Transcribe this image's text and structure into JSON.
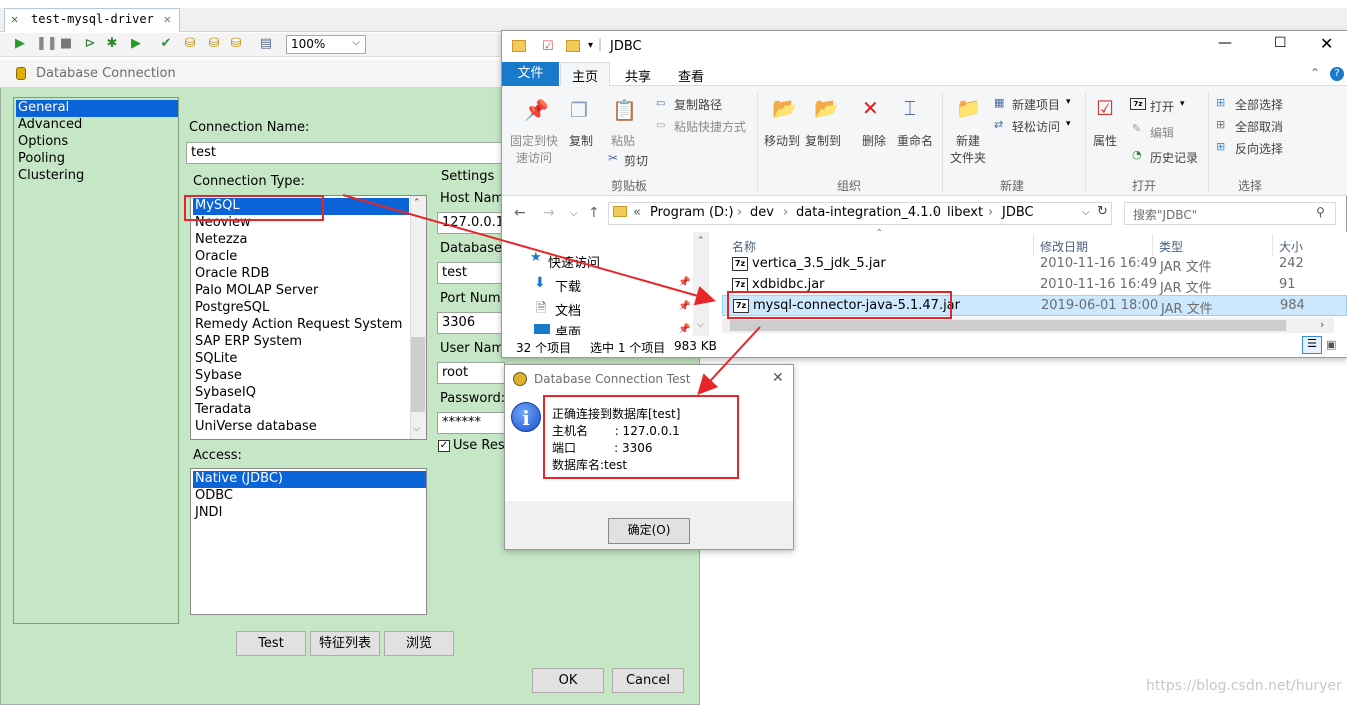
{
  "spoon": {
    "tab_label": "test-mysql-driver",
    "tab_icon": "transform-icon",
    "zoom": "100%",
    "toolbar_icons": [
      "run-icon",
      "pause-icon",
      "stop-icon",
      "preview-icon",
      "debug-icon",
      "replay-icon",
      "verify-icon",
      "impact-icon",
      "sql-icon",
      "explore-db-icon",
      "show-results-icon"
    ]
  },
  "db_dialog": {
    "title": "Database Connection",
    "nav": [
      "General",
      "Advanced",
      "Options",
      "Pooling",
      "Clustering"
    ],
    "selected_nav": "General",
    "connection_name_label": "Connection Name:",
    "connection_name_value": "test",
    "connection_type_label": "Connection Type:",
    "connection_types": [
      "MySQL",
      "Neoview",
      "Netezza",
      "Oracle",
      "Oracle RDB",
      "Palo MOLAP Server",
      "PostgreSQL",
      "Remedy Action Request System",
      "SAP ERP System",
      "SQLite",
      "Sybase",
      "SybaseIQ",
      "Teradata",
      "UniVerse database"
    ],
    "selected_type": "MySQL",
    "access_label": "Access:",
    "access_types": [
      "Native (JDBC)",
      "ODBC",
      "JNDI"
    ],
    "selected_access": "Native (JDBC)",
    "settings_label": "Settings",
    "host_label": "Host Name",
    "host_value": "127.0.0.1",
    "database_label": "Database",
    "database_value": "test",
    "port_label": "Port Numb",
    "port_value": "3306",
    "user_label": "User Name",
    "user_value": "root",
    "password_label": "Password:",
    "password_value": "******",
    "use_result_label": "Use Resu",
    "buttons": {
      "test": "Test",
      "features": "特征列表",
      "explore": "浏览",
      "ok": "OK",
      "cancel": "Cancel"
    }
  },
  "explorer": {
    "title": "JDBC",
    "tabs": {
      "file": "文件",
      "home": "主页",
      "share": "共享",
      "view": "查看"
    },
    "ribbon": {
      "pin": [
        "固定到快",
        "速访问"
      ],
      "copy": "复制",
      "paste": "粘贴",
      "copy_path": "复制路径",
      "paste_shortcut": "粘贴快捷方式",
      "cut": "剪切",
      "clipboard": "剪贴板",
      "move_to": "移动到",
      "copy_to": "复制到",
      "delete": "删除",
      "rename": "重命名",
      "organize": "组织",
      "new_folder": [
        "新建",
        "文件夹"
      ],
      "new_item": "新建项目",
      "easy_access": "轻松访问",
      "new_group": "新建",
      "properties": "属性",
      "open": "打开",
      "edit": "编辑",
      "history": "历史记录",
      "open_group": "打开",
      "select_all": "全部选择",
      "select_none": "全部取消",
      "invert_selection": "反向选择",
      "select_group": "选择"
    },
    "breadcrumb": [
      "«",
      "Program (D:)",
      "dev",
      "data-integration_4.1.0",
      "libext",
      "JDBC"
    ],
    "search_placeholder": "搜索\"JDBC\"",
    "columns": {
      "name": "名称",
      "date": "修改日期",
      "type": "类型",
      "size": "大小"
    },
    "nav_items": [
      "快速访问",
      "下载",
      "文档",
      "桌面"
    ],
    "files": [
      {
        "name": "vertica_3.5_jdk_5.jar",
        "date": "2010-11-16 16:49",
        "type": "JAR 文件",
        "size": "242"
      },
      {
        "name": "xdbidbc.jar",
        "date": "2010-11-16 16:49",
        "type": "JAR 文件",
        "size": "91"
      },
      {
        "name": "mysql-connector-java-5.1.47.jar",
        "date": "2019-06-01 18:00",
        "type": "JAR 文件",
        "size": "984"
      }
    ],
    "status": {
      "count": "32 个项目",
      "selected": "选中 1 个项目",
      "size": "983 KB"
    }
  },
  "test_dialog": {
    "title": "Database Connection Test",
    "line1": "正确连接到数据库[test]",
    "line2": "主机名       : 127.0.0.1",
    "line3": "端口          : 3306",
    "line4": "数据库名:test",
    "ok_label": "确定(O)"
  },
  "watermark": "https://blog.csdn.net/huryer",
  "colors": {
    "accent": "#0a64d8",
    "dialog_bg": "#c6e7c6",
    "annotation": "#e8262a",
    "ribbon_file_tab": "#1979ca"
  }
}
